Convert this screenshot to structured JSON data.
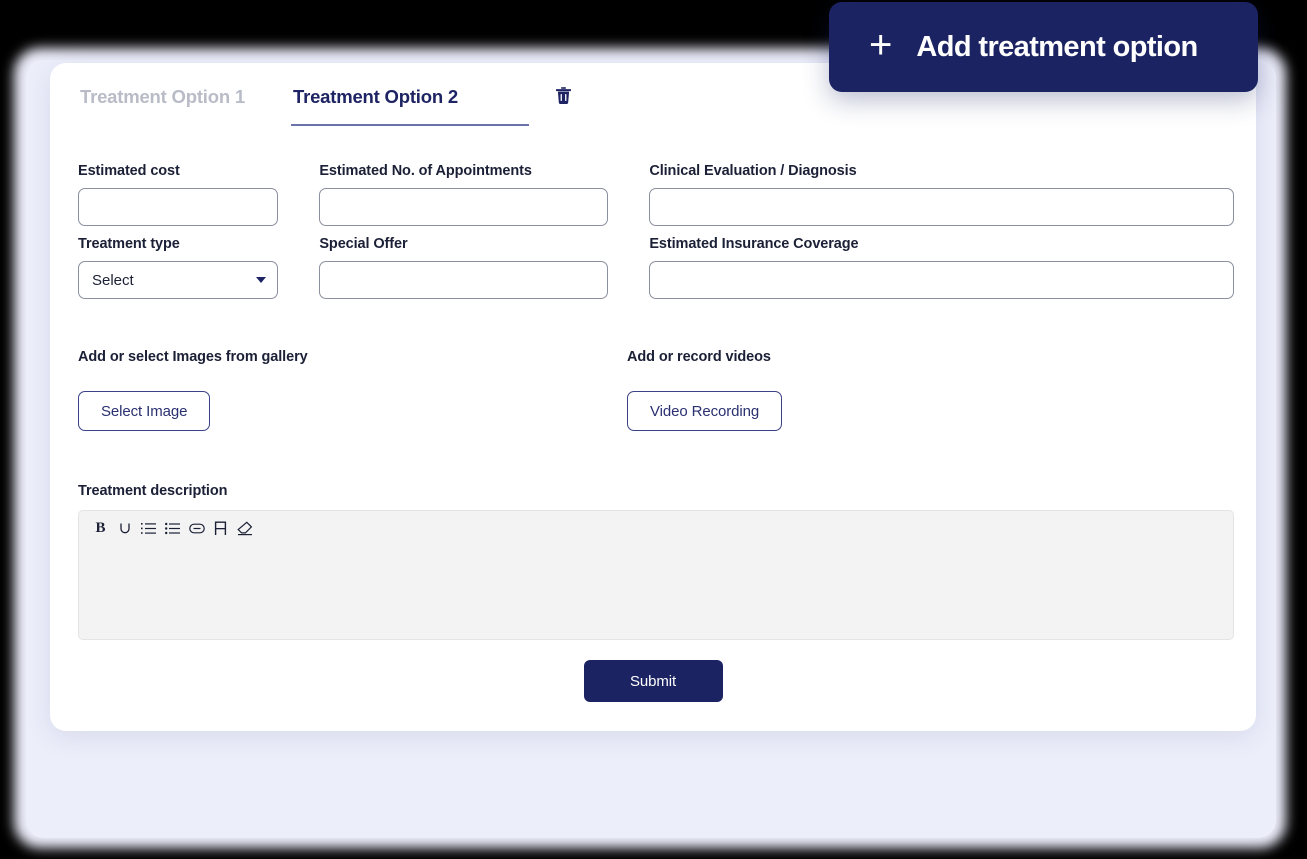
{
  "colors": {
    "navy": "#1c2363",
    "navy_text": "#1d2363",
    "inactive_tab": "#b9bcc7",
    "label_text": "#1b2036",
    "input_border": "#8c8f9e",
    "page_background": "#eceefa",
    "card_background": "#ffffff",
    "editor_background": "#f3f3f3"
  },
  "add_button": {
    "label": "Add treatment option",
    "icon": "plus-icon"
  },
  "tabs": [
    {
      "label": "Treatment Option 1",
      "active": false
    },
    {
      "label": "Treatment Option 2",
      "active": true
    }
  ],
  "delete_tab": {
    "icon": "trash-icon",
    "title": "Delete treatment option"
  },
  "form": {
    "estimated_cost": {
      "label": "Estimated cost",
      "value": "",
      "placeholder": ""
    },
    "estimated_appointments": {
      "label": "Estimated No. of Appointments",
      "value": "",
      "placeholder": ""
    },
    "clinical_evaluation": {
      "label": "Clinical Evaluation / Diagnosis",
      "value": "",
      "placeholder": ""
    },
    "treatment_type": {
      "label": "Treatment type",
      "selected": "Select",
      "options": [
        "Select"
      ]
    },
    "special_offer": {
      "label": "Special Offer",
      "value": "",
      "placeholder": ""
    },
    "insurance_coverage": {
      "label": "Estimated Insurance Coverage",
      "value": "",
      "placeholder": ""
    }
  },
  "media": {
    "images": {
      "label": "Add or select Images from gallery",
      "button": "Select Image"
    },
    "videos": {
      "label": "Add or record videos",
      "button": "Video Recording"
    }
  },
  "description": {
    "label": "Treatment description",
    "value": "",
    "placeholder": "",
    "toolbar": [
      {
        "name": "bold-icon",
        "glyph": "B"
      },
      {
        "name": "underline-icon",
        "glyph": "U"
      },
      {
        "name": "numbered-list-icon",
        "glyph": ""
      },
      {
        "name": "bullet-list-icon",
        "glyph": ""
      },
      {
        "name": "link-icon",
        "glyph": ""
      },
      {
        "name": "font-icon",
        "glyph": "A"
      },
      {
        "name": "clear-format-icon",
        "glyph": ""
      }
    ]
  },
  "submit": {
    "label": "Submit"
  }
}
